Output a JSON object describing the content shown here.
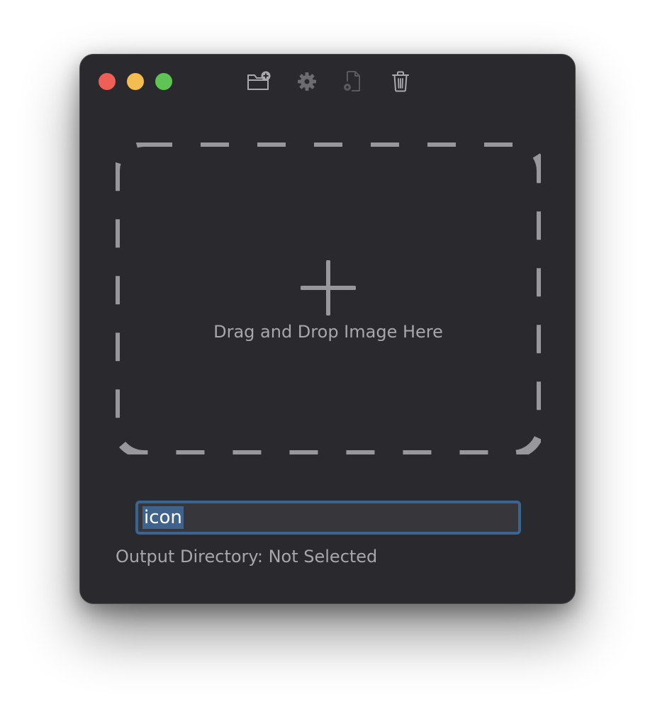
{
  "window": {
    "buttons": {
      "close": "close",
      "minimize": "minimize",
      "zoom": "zoom"
    }
  },
  "toolbar": {
    "items": [
      {
        "icon": "folder-add-icon",
        "enabled": true
      },
      {
        "icon": "gear-icon",
        "enabled": true
      },
      {
        "icon": "document-settings-icon",
        "enabled": false
      },
      {
        "icon": "trash-icon",
        "enabled": true
      }
    ]
  },
  "dropzone": {
    "icon": "plus-icon",
    "label": "Drag and Drop Image Here"
  },
  "filename": {
    "value": "icon"
  },
  "output": {
    "label": "Output Directory: Not Selected"
  },
  "colors": {
    "window_bg": "#2a2a2e",
    "dashed_border": "#98989c",
    "accent": "#3a6491"
  }
}
